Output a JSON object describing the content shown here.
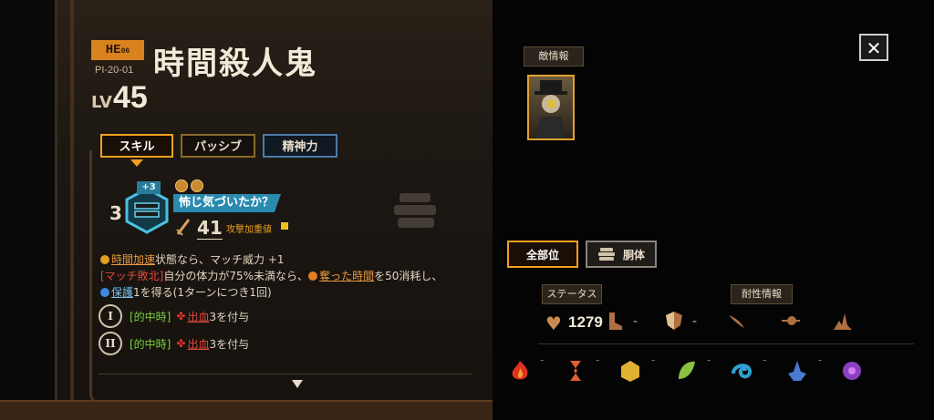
{
  "enemy": {
    "rank": "HE",
    "rank_suffix": "06",
    "code": "PI-20-01",
    "name": "時間殺人鬼",
    "lv_label": "LV",
    "lv_value": "45"
  },
  "tabs": {
    "skill": "スキル",
    "passive": "パッシブ",
    "spirit": "精神力"
  },
  "skill": {
    "count": "3",
    "power_tag": "+3",
    "name": "怖じ気づいたか？",
    "atk_value": "41",
    "atk_label": "攻撃加重値",
    "desc_line1_kw": "時間加速",
    "desc_line1_rest": "状態なら、マッチ威力 +1",
    "desc_line2_kw": "[マッチ敗北]",
    "desc_line2_mid": "自分の体力が75%未満なら、",
    "desc_line2_kw2": "奪った時間",
    "desc_line2_rest": "を50消耗し、",
    "desc_line3_kw": "保護",
    "desc_line3_rest": "1を得る(1ターンにつき1回)",
    "effects": [
      {
        "numeral": "I",
        "hit": "[的中時]",
        "kw": "出血",
        "rest": "3を付与"
      },
      {
        "numeral": "II",
        "hit": "[的中時]",
        "kw": "出血",
        "rest": "3を付与"
      }
    ]
  },
  "side": {
    "enemy_info_label": "敵情報",
    "close": "✕",
    "all_parts": "全部位",
    "body": "胴体",
    "status_label": "ステータス",
    "resist_label": "耐性情報",
    "hp": "1279",
    "dash": "-"
  },
  "colors": {
    "accent": "#f0a020",
    "skill_name_bg": "#2a8ab0",
    "bleed": "#e04a3a"
  }
}
